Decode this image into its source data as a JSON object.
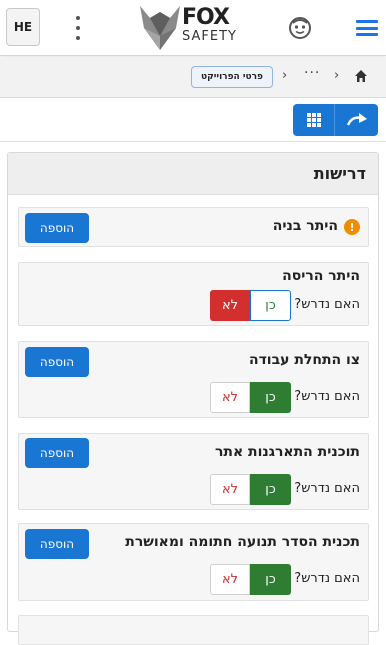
{
  "header": {
    "language_button": "HE",
    "logo_main": "FOX",
    "logo_sub": "SAFETY",
    "accent_color": "#1976d2"
  },
  "breadcrumb": {
    "ellipsis": "···",
    "current": "פרטי הפרוייקט"
  },
  "panel": {
    "title": "דרישות"
  },
  "requirements": [
    {
      "title": "היתר בניה",
      "has_warning": true,
      "add_label": "הוספה"
    },
    {
      "title": "היתר הריסה",
      "question": "האם נדרש?",
      "yes_label": "כן",
      "no_label": "לא",
      "selected": "לא"
    },
    {
      "title": "צו התחלת עבודה",
      "add_label": "הוספה",
      "question": "האם נדרש?",
      "yes_label": "כן",
      "no_label": "לא",
      "selected": "כן"
    },
    {
      "title": "תוכנית התארגנות אתר",
      "add_label": "הוספה",
      "question": "האם נדרש?",
      "yes_label": "כן",
      "no_label": "לא",
      "selected": "כן"
    },
    {
      "title": "תכנית הסדר תנועה חתומה ומאושרת",
      "add_label": "הוספה",
      "question": "האם נדרש?",
      "yes_label": "כן",
      "no_label": "לא",
      "selected": "כן"
    }
  ],
  "colors": {
    "yes_active": "#2e7d32",
    "no_active": "#d32f2f",
    "warning": "#f08c00"
  }
}
